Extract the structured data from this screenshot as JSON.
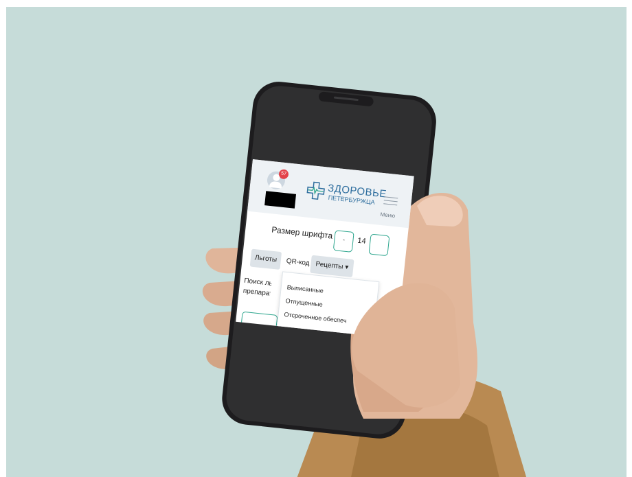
{
  "header": {
    "notification_count": "57",
    "logo_line1": "ЗДОРОВЬЕ",
    "logo_line2": "ПЕТЕРБУРЖЦА",
    "menu_label": "Меню"
  },
  "font_size": {
    "label": "Размер шрифта",
    "decrease": "-",
    "value": "14"
  },
  "tabs": [
    {
      "label": "Льготы"
    },
    {
      "label": "QR-код"
    },
    {
      "label": "Рецепты ▾"
    }
  ],
  "search_label_line1": "Поиск льго",
  "search_label_line2": "препаратов",
  "dropdown": {
    "items": [
      {
        "label": "Выписанные"
      },
      {
        "label": "Отпущенные"
      },
      {
        "label": "Отсроченное обеспеч"
      }
    ]
  },
  "colors": {
    "background": "#c6dcd9",
    "accent": "#2ca58d",
    "brand": "#2e6e9e",
    "badge": "#e3434a"
  }
}
